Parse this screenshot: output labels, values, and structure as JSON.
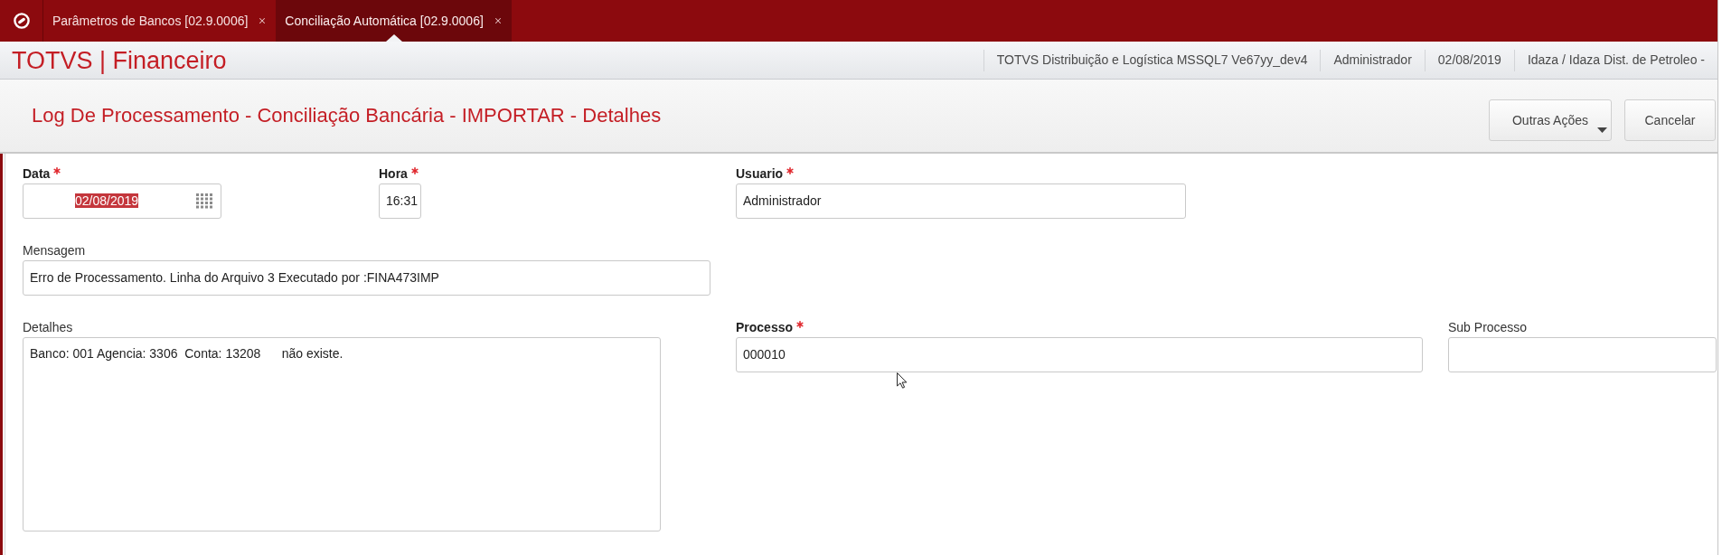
{
  "tabs": [
    {
      "label": "Parâmetros de Bancos [02.9.0006]",
      "selected": false
    },
    {
      "label": "Conciliação Automática [02.9.0006]",
      "selected": true
    }
  ],
  "app_bar": {
    "title": "TOTVS | Financeiro",
    "info": [
      "TOTVS Distribuição e Logística MSSQL7 Ve67yy_dev4",
      "Administrador",
      "02/08/2019",
      "Idaza / Idaza Dist. de Petroleo -"
    ]
  },
  "page_header": {
    "title": "Log De Processamento - Conciliação Bancária - IMPORTAR - Detalhes",
    "buttons": [
      {
        "label": "Outras Ações",
        "kind": "dropdown"
      },
      {
        "label": "Cancelar",
        "kind": "plain"
      }
    ]
  },
  "form": {
    "fields": [
      {
        "label": "Data",
        "required": true,
        "kind": "date",
        "value": "02/08/2019",
        "text_selected": true
      },
      {
        "label": "Hora",
        "required": true,
        "kind": "text",
        "value": "16:31",
        "text_selected": false
      },
      {
        "label": "Usuario",
        "required": true,
        "kind": "text",
        "value": "Administrador",
        "text_selected": false
      },
      {
        "label": "Mensagem",
        "required": false,
        "kind": "text",
        "value": "Erro de Processamento. Linha do Arquivo 3 Executado por :FINA473IMP",
        "text_selected": false
      },
      {
        "label": "Detalhes",
        "required": false,
        "kind": "textarea",
        "value": "Banco: 001 Agencia: 3306  Conta: 13208      não existe.",
        "text_selected": false
      },
      {
        "label": "Processo",
        "required": true,
        "kind": "text",
        "value": "000010",
        "text_selected": false
      },
      {
        "label": "Sub Processo",
        "required": false,
        "kind": "text",
        "text_selected": false
      }
    ]
  }
}
